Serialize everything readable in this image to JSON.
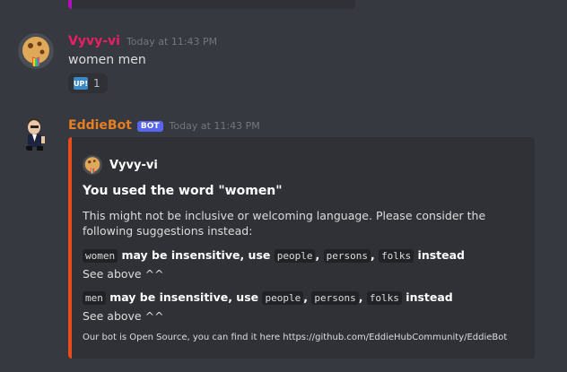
{
  "colors": {
    "background": "#36393f",
    "embed_bg": "#2f3136",
    "user1_name": "#e91e63",
    "bot_name": "#e67e22",
    "embed_accent": "#e74c1c",
    "prev_embed_accent": "#b40ebd",
    "bot_tag": "#5865f2"
  },
  "message1": {
    "avatar_icon": "cookie-rainbow-avatar",
    "username": "Vyvy-vi",
    "timestamp": "Today at 11:43 PM",
    "text": "women men",
    "reaction": {
      "emoji_text": "UP!",
      "count": "1"
    }
  },
  "message2": {
    "avatar_icon": "cartoon-man-avatar",
    "username": "EddieBot",
    "bot_tag": "BOT",
    "timestamp": "Today at 11:43 PM",
    "embed": {
      "author_name": "Vyvy-vi",
      "title": "You used the word \"women\"",
      "description": "This might not be inclusive or welcoming language. Please consider the following suggestions instead:",
      "fields": [
        {
          "word": "women",
          "middle": "may be insensitive, use",
          "suggestions": [
            "people",
            "persons",
            "folks"
          ],
          "end": "instead",
          "value": "See above ^^"
        },
        {
          "word": "men",
          "middle": "may be insensitive, use",
          "suggestions": [
            "people",
            "persons",
            "folks"
          ],
          "end": "instead",
          "value": "See above ^^"
        }
      ],
      "footer": "Our bot is Open Source, you can find it here https://github.com/EddieHubCommunity/EddieBot"
    }
  }
}
